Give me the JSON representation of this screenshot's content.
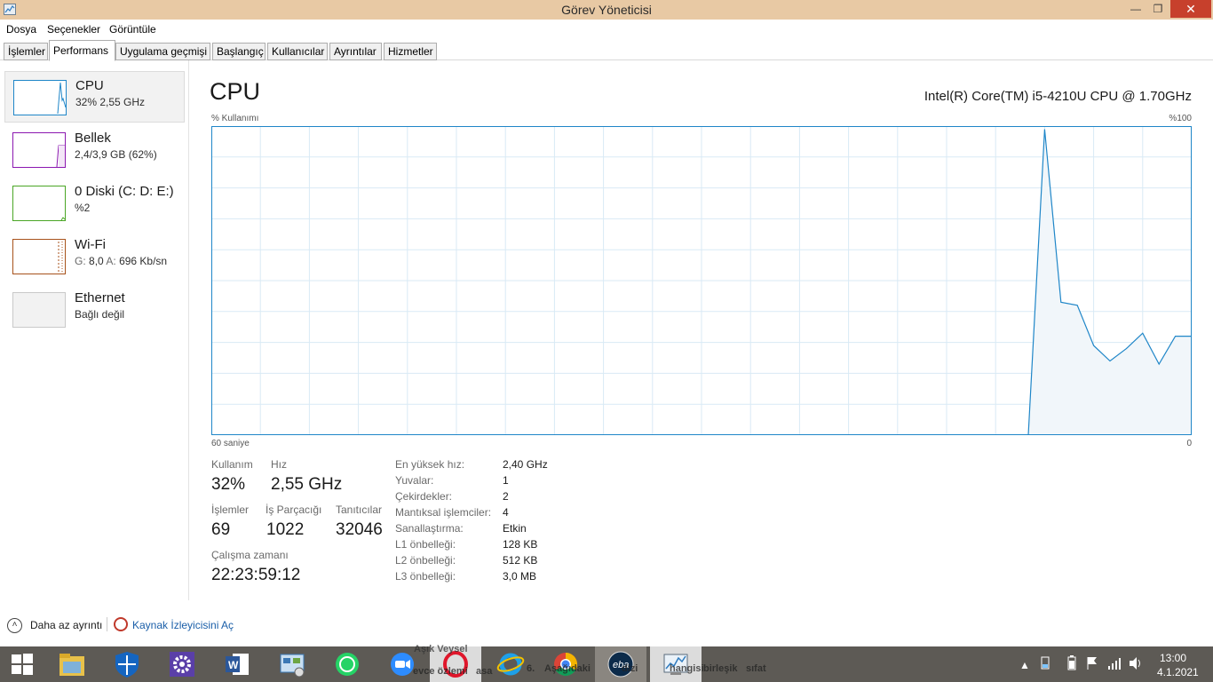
{
  "window": {
    "title": "Görev Yöneticisi",
    "close_glyph": "✕",
    "max_glyph": "❐",
    "min_glyph": "—"
  },
  "menu": [
    "Dosya",
    "Seçenekler",
    "Görüntüle"
  ],
  "tabs": [
    "İşlemler",
    "Performans",
    "Uygulama geçmişi",
    "Başlangıç",
    "Kullanıcılar",
    "Ayrıntılar",
    "Hizmetler"
  ],
  "active_tab": "Performans",
  "sidebar": {
    "items": [
      {
        "name": "CPU",
        "sub": "32% 2,55 GHz",
        "color": "#1f86c8"
      },
      {
        "name": "Bellek",
        "sub": "2,4/3,9 GB (62%)",
        "color": "#8b18b0"
      },
      {
        "name": "0 Diski (C: D: E:)",
        "sub": "%2",
        "color": "#4aa625"
      },
      {
        "name": "Wi-Fi",
        "sub_g_label": "G:",
        "sub_g": "8,0",
        "sub_a_label": "A:",
        "sub_a": "696 Kb/sn",
        "color": "#a7521b"
      },
      {
        "name": "Ethernet",
        "sub": "Bağlı değil",
        "color": "#b8b8b8"
      }
    ]
  },
  "main": {
    "title": "CPU",
    "model": "Intel(R) Core(TM) i5-4210U CPU @ 1.70GHz",
    "graph_label": "% Kullanımı",
    "graph_max": "%100",
    "graph_time": "60 saniye",
    "graph_min": "0"
  },
  "chart_data": {
    "type": "area",
    "x": [
      0,
      1,
      2,
      3,
      4,
      5,
      6,
      7,
      8,
      9,
      10,
      11,
      12,
      13,
      14,
      15,
      16,
      17,
      18,
      19,
      20,
      21,
      22,
      23,
      24,
      25,
      26,
      27,
      28,
      29,
      30,
      31,
      32,
      33,
      34,
      35,
      36,
      37,
      38,
      39,
      40,
      41,
      42,
      43,
      44,
      45,
      46,
      47,
      48,
      49,
      50,
      51,
      52,
      53,
      54,
      55,
      56,
      57,
      58,
      59,
      60
    ],
    "values": [
      0,
      0,
      0,
      0,
      0,
      0,
      0,
      0,
      0,
      0,
      0,
      0,
      0,
      0,
      0,
      0,
      0,
      0,
      0,
      0,
      0,
      0,
      0,
      0,
      0,
      0,
      0,
      0,
      0,
      0,
      0,
      0,
      0,
      0,
      0,
      0,
      0,
      0,
      0,
      0,
      0,
      0,
      0,
      0,
      0,
      0,
      0,
      0,
      0,
      0,
      0,
      99,
      43,
      42,
      29,
      24,
      28,
      33,
      23,
      32,
      32
    ],
    "ylim": [
      0,
      100
    ],
    "color": "#1f86c8",
    "fill": "#f1f6fa",
    "grid": true
  },
  "stats": {
    "kullanim_label": "Kullanım",
    "kullanim": "32%",
    "hiz_label": "Hız",
    "hiz": "2,55 GHz",
    "islemler_label": "İşlemler",
    "islemler": "69",
    "is_parcacigi_label": "İş Parçacığı",
    "is_parcacigi": "1022",
    "taniticilar_label": "Tanıtıcılar",
    "taniticilar": "32046",
    "calisma_label": "Çalışma zamanı",
    "calisma": "22:23:59:12"
  },
  "details": [
    {
      "label": "En yüksek hız:",
      "value": "2,40 GHz"
    },
    {
      "label": "Yuvalar:",
      "value": "1"
    },
    {
      "label": "Çekirdekler:",
      "value": "2"
    },
    {
      "label": "Mantıksal işlemciler:",
      "value": "4"
    },
    {
      "label": "Sanallaştırma:",
      "value": "Etkin"
    },
    {
      "label": "L1 önbelleği:",
      "value": "128 KB"
    },
    {
      "label": "L2 önbelleği:",
      "value": "512 KB"
    },
    {
      "label": "L3 önbelleği:",
      "value": "3,0 MB"
    }
  ],
  "bottom": {
    "less_detail": "Daha az ayrıntı",
    "resource_monitor": "Kaynak İzleyicisini Aç"
  },
  "taskbar": {
    "ghost_texts": [
      "Aşık Veysel",
      "evce özlemi",
      "asa",
      "6.",
      "Aşağıdaki",
      "dizi",
      "hangisi",
      "birleşik",
      "sıfat"
    ],
    "clock_time": "13:00",
    "clock_date": "4.1.2021"
  }
}
